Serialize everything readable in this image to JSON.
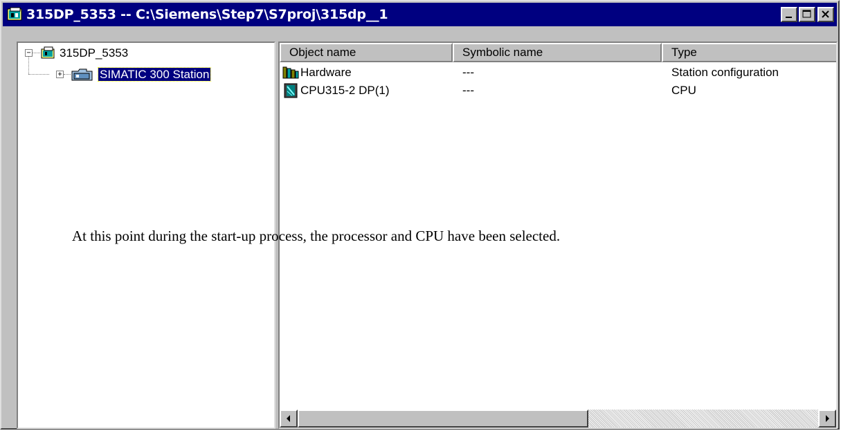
{
  "window": {
    "title": "315DP_5353 -- C:\\Siemens\\Step7\\S7proj\\315dp__1",
    "controls": {
      "minimize": "minimize-icon",
      "maximize": "maximize-icon",
      "close": "close-icon"
    }
  },
  "tree": {
    "root": {
      "label": "315DP_5353",
      "toggle": "−",
      "icon": "project-icon"
    },
    "child": {
      "label": "SIMATIC 300 Station",
      "toggle": "+",
      "icon": "station-icon",
      "selected": true
    }
  },
  "list": {
    "columns": [
      "Object name",
      "Symbolic name",
      "Type"
    ],
    "rows": [
      {
        "name": "Hardware",
        "symbolic": "---",
        "type": "Station configuration",
        "icon": "hardware-icon"
      },
      {
        "name": "CPU315-2 DP(1)",
        "symbolic": "---",
        "type": "CPU",
        "icon": "cpu-icon"
      }
    ]
  },
  "caption": "At this point during the start-up process, the processor and CPU have been selected.",
  "colors": {
    "titlebar": "#000080",
    "face": "#c0c0c0",
    "selection": "#000080"
  }
}
